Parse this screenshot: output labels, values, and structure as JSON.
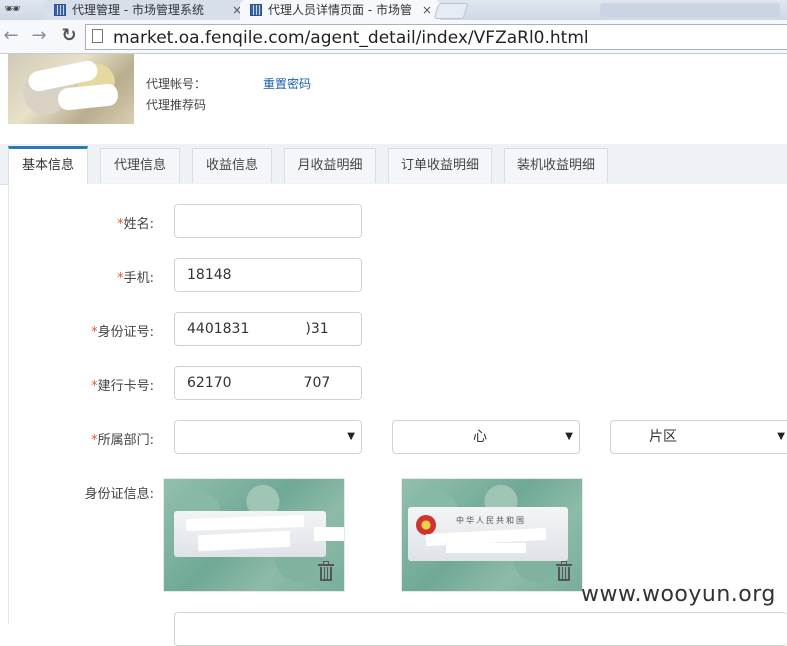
{
  "browser": {
    "tabs": [
      {
        "title": "代理管理 - 市场管理系统"
      },
      {
        "title": "代理人员详情页面 - 市场管"
      }
    ],
    "close_glyph": "×",
    "url": "market.oa.fenqile.com/agent_detail/index/VFZaRl0.html"
  },
  "agent": {
    "account_label": "代理帐号：",
    "reset_password": "重置密码",
    "referral_label": "代理推荐码"
  },
  "tabs": [
    {
      "label": "基本信息"
    },
    {
      "label": "代理信息"
    },
    {
      "label": "收益信息"
    },
    {
      "label": "月收益明细"
    },
    {
      "label": "订单收益明细"
    },
    {
      "label": "装机收益明细"
    }
  ],
  "form": {
    "required_mark": "*",
    "name_label": "姓名:",
    "name_value": "",
    "phone_label": "手机:",
    "phone_value": "18148",
    "id_label": "身份证号:",
    "id_value_start": "4401831",
    "id_value_end": ")31",
    "card_label": "建行卡号:",
    "card_value_start": "62170",
    "card_value_end": "707",
    "dept_label": "所属部门:",
    "dept_select1": "",
    "dept_select2": "心",
    "dept_select3": "片区",
    "idinfo_label": "身份证信息:",
    "card_back_text": "中华人民共和国"
  },
  "watermark": "www.wooyun.org",
  "icons": {
    "back": "←",
    "forward": "→",
    "reload": "↻",
    "dropdown": "▼"
  }
}
